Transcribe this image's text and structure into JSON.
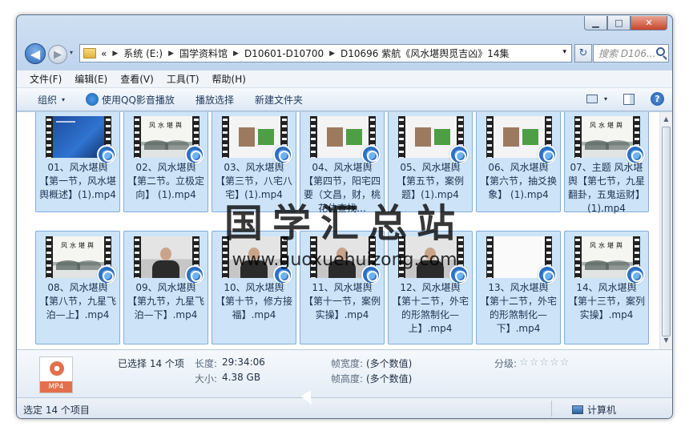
{
  "window": {
    "minimize": "▁",
    "maximize": "□",
    "close": "✕"
  },
  "nav": {
    "back": "◀",
    "forward": "▶",
    "dropdown": "▾",
    "refresh": "↻"
  },
  "address": {
    "lead": "«",
    "crumbs": [
      "系统 (E:)",
      "国学资料馆",
      "D10601-D10700",
      "D10696 紫航《风水堪舆觅吉凶》14集"
    ],
    "sep": "▶",
    "dropdown": "▾"
  },
  "search": {
    "placeholder": "搜索 D106..."
  },
  "menu": [
    "文件(F)",
    "编辑(E)",
    "查看(V)",
    "工具(T)",
    "帮助(H)"
  ],
  "toolbar": {
    "organize": "组织",
    "organize_arrow": "▾",
    "play_qq": "使用QQ影音播放",
    "play_select": "播放选择",
    "new_folder": "新建文件夹",
    "view_arrow": "▾",
    "help": "?"
  },
  "scrollbar": {
    "up": "▲",
    "down": "▼"
  },
  "files": [
    {
      "label": "01、风水堪舆【第一节，风水堪舆概述】(1).mp4",
      "art": "blue"
    },
    {
      "label": "02、风水堪舆【第二节。立极定向】 (1).mp4",
      "art": "ink",
      "thumb_text": "风水堪舆"
    },
    {
      "label": "03、风水堪舆【第三节，八宅八宅】(1).mp4",
      "art": "slide"
    },
    {
      "label": "04、风水堪舆【第四节，阳宅四要（文昌，财，桃花位查找…",
      "art": "slide"
    },
    {
      "label": "05、风水堪舆【第五节，案例题】(1).mp4",
      "art": "slide"
    },
    {
      "label": "06、风水堪舆【第六节，抽爻换象】 (1).mp4",
      "art": "slide"
    },
    {
      "label": "07、主题 风水堪舆【第七节，九星翻卦，五鬼运财】 (1).mp4",
      "art": "ink",
      "thumb_text": "风水堪舆"
    },
    {
      "label": "08、风水堪舆【第八节，九星飞泊—上】.mp4",
      "art": "ink",
      "thumb_text": "风水堪舆"
    },
    {
      "label": "09、风水堪舆【第九节，九星飞泊—下】.mp4",
      "art": "person"
    },
    {
      "label": "10、风水堪舆【第十节，修方接福】.mp4",
      "art": "person"
    },
    {
      "label": "11、风水堪舆【第十一节，案例实操】.mp4",
      "art": "person"
    },
    {
      "label": "12、风水堪舆【第十二节，外宅的形煞制化—上】.mp4",
      "art": "person"
    },
    {
      "label": "13、风水堪舆【第十二节，外宅的形煞制化—下】.mp4",
      "art": "blank"
    },
    {
      "label": "14、风水堪舆【第十三节，案列实操】.mp4",
      "art": "ink",
      "thumb_text": "风水堪舆"
    }
  ],
  "watermark": {
    "cn": "国学汇总站",
    "url": "www.guoxuehuizong.com"
  },
  "details": {
    "icon_label": "MP4",
    "selected": "已选择 14 个项",
    "length_label": "长度:",
    "length_value": "29:34:06",
    "size_label": "大小:",
    "size_value": "4.38 GB",
    "width_label": "帧宽度:",
    "width_value": "(多个数值)",
    "height_label": "帧高度:",
    "height_value": "(多个数值)",
    "rating_label": "分级:",
    "stars": "☆☆☆☆☆"
  },
  "status": {
    "left": "选定 14 个项目",
    "right": "计算机"
  }
}
